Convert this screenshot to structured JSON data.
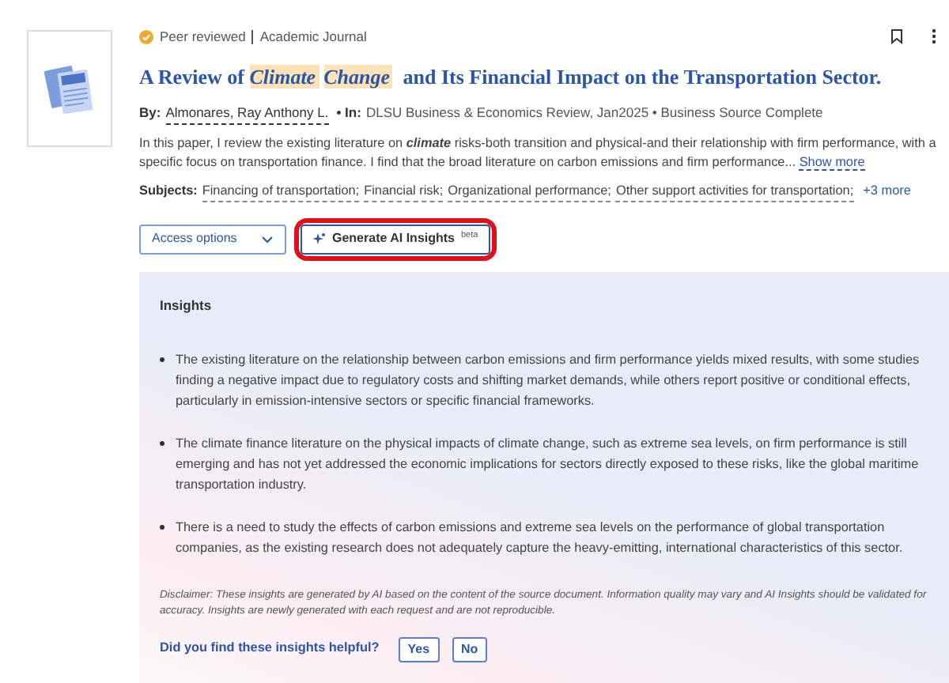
{
  "result": {
    "badges": [
      "Peer reviewed",
      "Academic Journal"
    ],
    "peer_reviewed": true,
    "title_parts": [
      {
        "text": "A Review of ",
        "highlighted": false
      },
      {
        "text": "Climate",
        "highlighted": true
      },
      {
        "text": "Change",
        "highlighted": true
      },
      {
        "text": " and Its Financial Impact on the Transportation Sector.",
        "highlighted": false
      }
    ],
    "by_label": "By:",
    "author": "Almonares, Ray Anthony L.",
    "in_label": "• In:",
    "source": "DLSU Business & Economics Review, Jan2025 • Business Source Complete",
    "abstract": "In this paper, I review the existing literature on **climate** risks-both transition and physical-and their relationship with firm performance, with a specific focus on transportation finance. I find that the broad literature on carbon emissions and firm performance...",
    "show_more": "Show more",
    "subjects_label": "Subjects:",
    "subjects": [
      "Financing of transportation;",
      "Financial risk;",
      "Organizational performance;",
      "Other support activities for transportation;"
    ],
    "more_subjects": "+3 more",
    "access_button": "Access options",
    "ai_button": {
      "label": "Generate AI Insights",
      "tag": "beta",
      "circled": true
    }
  },
  "insights": {
    "heading": "Insights",
    "points": [
      "The existing literature on the relationship between carbon emissions and firm performance yields mixed results, with some studies finding a negative impact due to regulatory costs and shifting market demands, while others report positive or conditional effects, particularly in emission-intensive sectors or specific financial frameworks.",
      "The climate finance literature on the physical impacts of climate change, such as extreme sea levels, on firm performance is still emerging and has not yet addressed the economic implications for sectors directly exposed to these risks, like the global maritime transportation industry.",
      "There is a need to study the effects of carbon emissions and extreme sea levels on the performance of global transportation companies, as the existing research does not adequately capture the heavy-emitting, international characteristics of this sector."
    ],
    "disclaimer": "Disclaimer: These insights are generated by AI based on the content of the source document. Information quality may vary and AI Insights should be validated for accuracy. Insights are newly generated with each request and are not reproducible.",
    "feedback_question": "Did you find these insights helpful?",
    "feedback_buttons": [
      "Yes",
      "No"
    ]
  }
}
